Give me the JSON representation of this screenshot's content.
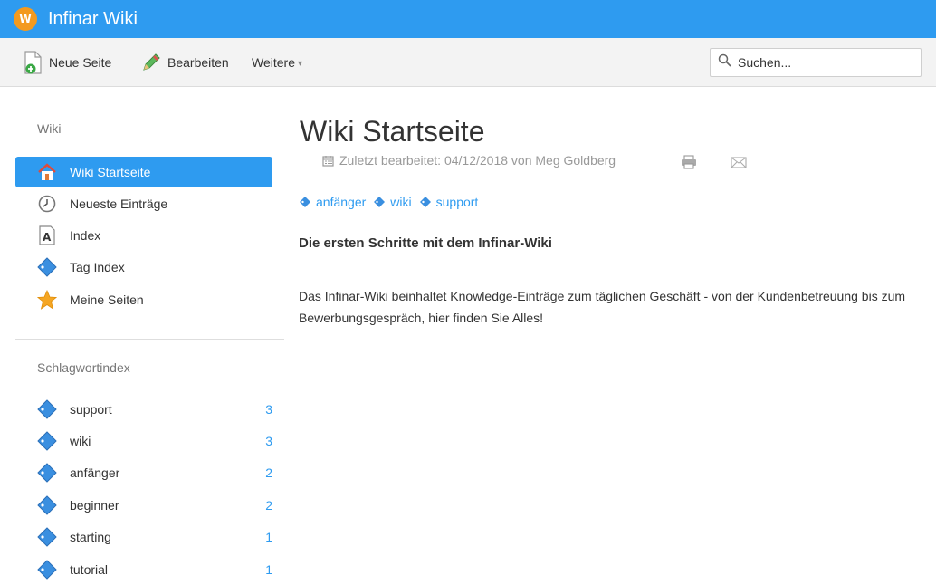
{
  "app": {
    "title": "Infinar Wiki",
    "logo_text": "W",
    "accent": "#2e9bf0",
    "logo_color": "#f39a1f"
  },
  "toolbar": {
    "new_page": {
      "label": "Neue Seite",
      "icon": "new-page-icon"
    },
    "edit": {
      "label": "Bearbeiten",
      "icon": "pencil-icon"
    },
    "more": {
      "label": "Weitere",
      "icon": "chevron-down-icon",
      "chevron": "▾"
    }
  },
  "search": {
    "placeholder": "Suchen...",
    "icon": "search-icon"
  },
  "sidebar": {
    "wiki_heading": "Wiki",
    "items": [
      {
        "label": "Wiki Startseite",
        "icon": "home-icon",
        "active": true
      },
      {
        "label": "Neueste Einträge",
        "icon": "clock-icon",
        "active": false
      },
      {
        "label": "Index",
        "icon": "index-icon",
        "active": false
      },
      {
        "label": "Tag Index",
        "icon": "tag-icon",
        "active": false
      },
      {
        "label": "Meine Seiten",
        "icon": "star-icon",
        "active": false
      }
    ],
    "tag_heading": "Schlagwortindex",
    "tags": [
      {
        "label": "support",
        "count": "3"
      },
      {
        "label": "wiki",
        "count": "3"
      },
      {
        "label": "anfänger",
        "count": "2"
      },
      {
        "label": "beginner",
        "count": "2"
      },
      {
        "label": "starting",
        "count": "1"
      },
      {
        "label": "tutorial",
        "count": "1"
      }
    ]
  },
  "main": {
    "title": "Wiki Startseite",
    "meta": "Zuletzt bearbeitet: 04/12/2018 von Meg Goldberg",
    "tags": [
      "anfänger",
      "wiki",
      "support"
    ],
    "heading": "Die ersten Schritte mit dem Infinar-Wiki",
    "body": "Das Infinar-Wiki beinhaltet Knowledge-Einträge zum täglichen Geschäft - von der Kundenbetreuung bis zum Bewerbungsgespräch, hier finden Sie Alles!"
  }
}
